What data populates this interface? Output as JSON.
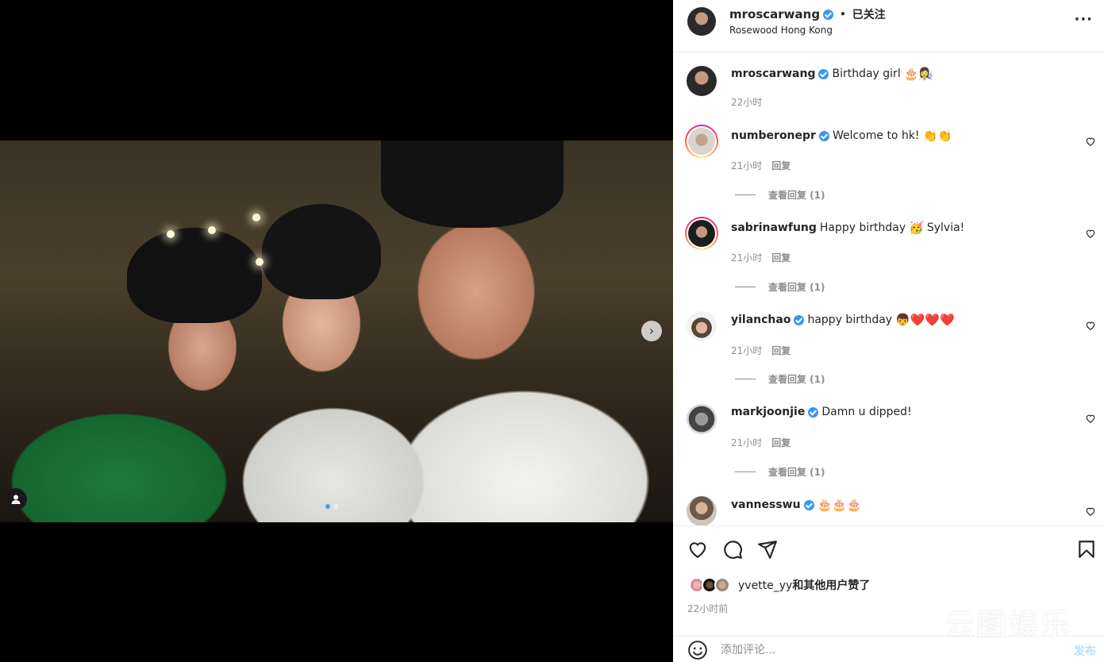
{
  "header": {
    "username": "mroscarwang",
    "separator": "•",
    "follow_status": "已关注",
    "location": "Rosewood Hong Kong",
    "more": "···"
  },
  "caption": {
    "username": "mroscarwang",
    "text": "Birthday girl",
    "emoji": "🎂👩‍🔬",
    "time": "22小时"
  },
  "comments": [
    {
      "username": "numberonepr",
      "text": "Welcome to hk!",
      "emoji": "👏👏",
      "time": "21小时",
      "reply": "回复",
      "view_replies": "查看回复 (1)"
    },
    {
      "username": "sabrinawfung",
      "text": "Happy birthday",
      "emoji": "🥳",
      "text2": "Sylvia!",
      "time": "21小时",
      "reply": "回复",
      "view_replies": "查看回复 (1)"
    },
    {
      "username": "yilanchao",
      "text": "happy birthday",
      "emoji": "👦❤️❤️❤️",
      "time": "21小时",
      "reply": "回复",
      "view_replies": "查看回复 (1)"
    },
    {
      "username": "markjoonjie",
      "text": "Damn u dipped!",
      "emoji": "",
      "time": "21小时",
      "reply": "回复",
      "view_replies": "查看回复 (1)"
    },
    {
      "username": "vannesswu",
      "text": "",
      "emoji": "🎂🎂🎂"
    }
  ],
  "likes": {
    "username": "yvette_yy",
    "suffix": "和其他用户赞了"
  },
  "post_time": "22小时前",
  "add_comment": {
    "placeholder": "添加评论...",
    "post_label": "发布"
  },
  "media": {
    "slide_current": 1,
    "slide_total": 2,
    "next_arrow": "›"
  },
  "watermark": "云图娱乐",
  "colors": {
    "verified": "#3897f0",
    "post_button": "#b2dffc",
    "muted": "#8e8e8e"
  }
}
